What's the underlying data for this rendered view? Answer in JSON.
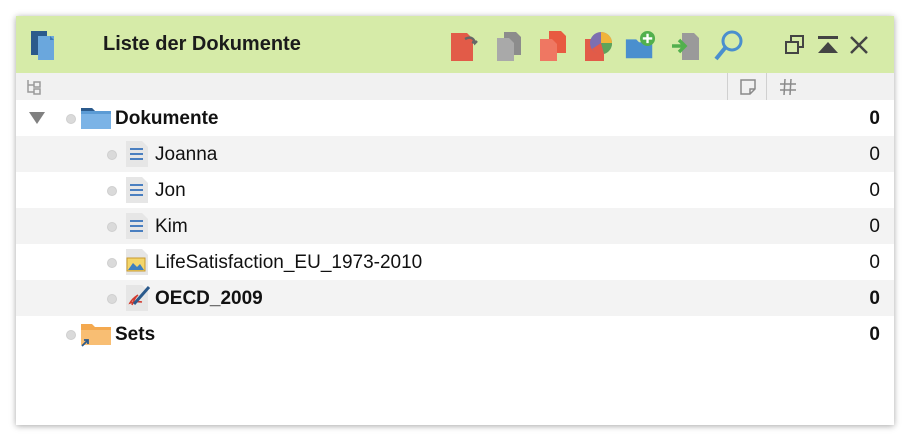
{
  "window": {
    "title": "Liste der Dokumente",
    "toolbar_icons": [
      "import-icon",
      "duplicate-icon",
      "documents-icon",
      "chart-icon",
      "new-folder-icon",
      "export-icon",
      "search-icon"
    ],
    "window_controls": [
      "restore-icon",
      "collapse-icon",
      "close-icon"
    ]
  },
  "columns": {
    "icons": [
      "tree-icon",
      "memo-icon",
      "hash-icon"
    ]
  },
  "tree": {
    "root": {
      "label": "Dokumente",
      "count": "0"
    },
    "items": [
      {
        "label": "Joanna",
        "count": "0",
        "type": "text"
      },
      {
        "label": "Jon",
        "count": "0",
        "type": "text"
      },
      {
        "label": "Kim",
        "count": "0",
        "type": "text"
      },
      {
        "label": "LifeSatisfaction_EU_1973-2010",
        "count": "0",
        "type": "image"
      },
      {
        "label": "OECD_2009",
        "count": "0",
        "type": "pdf"
      }
    ],
    "sets": {
      "label": "Sets",
      "count": "0"
    }
  },
  "colors": {
    "titlebar": "#d6eba8",
    "accent_red": "#e25b48",
    "folder_blue": "#5b9bd5",
    "folder_orange": "#f4a94f"
  }
}
